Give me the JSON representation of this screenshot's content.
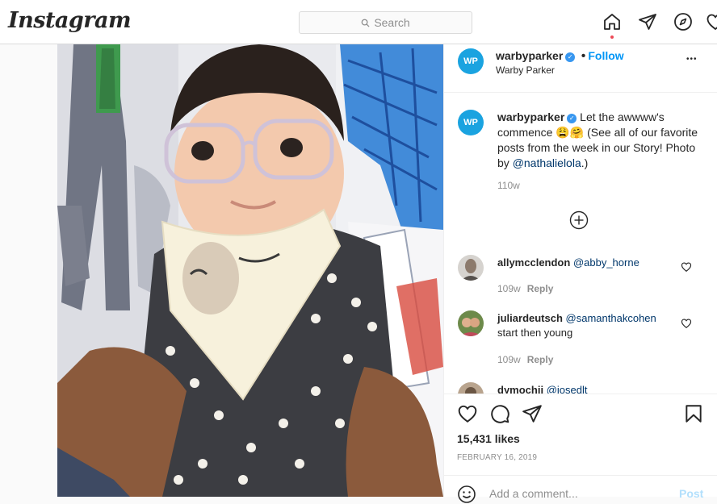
{
  "app": {
    "logo": "Instagram"
  },
  "search": {
    "placeholder": "Search"
  },
  "post": {
    "account": "warbyparker",
    "account_subtitle": "Warby Parker",
    "avatar_text": "WP",
    "follow_separator": "•",
    "follow_label": "Follow",
    "more_label": "•••",
    "caption_text_1": "Let the awwww's commence ",
    "caption_emoji": "😩🤗",
    "caption_text_2": " (See all of our favorite posts from the week in our Story! Photo by ",
    "caption_mention": "@nathalielola",
    "caption_text_3": ".)",
    "caption_time": "110w",
    "load_more_icon": "plus-circle-icon",
    "likes": "15,431 likes",
    "date": "FEBRUARY 16, 2019",
    "add_comment_placeholder": "Add a comment...",
    "post_label": "Post"
  },
  "comments": [
    {
      "user": "allymcclendon",
      "mention": "@abby_horne",
      "text": "",
      "time": "109w",
      "reply": "Reply"
    },
    {
      "user": "juliardeutsch",
      "mention": "@samanthakcohen",
      "text": "start then young",
      "time": "109w",
      "reply": "Reply"
    },
    {
      "user": "dymochii",
      "mention": "@josedlt",
      "text": "",
      "time": "",
      "reply": ""
    }
  ],
  "icons": {
    "nav": [
      "home-icon",
      "direct-icon",
      "explore-icon",
      "activity-icon"
    ],
    "actions": [
      "heart-icon",
      "comment-icon",
      "share-icon",
      "bookmark-icon"
    ]
  },
  "colors": {
    "accent": "#0095f6",
    "verified": "#3897f0",
    "notification": "#ed4956"
  }
}
